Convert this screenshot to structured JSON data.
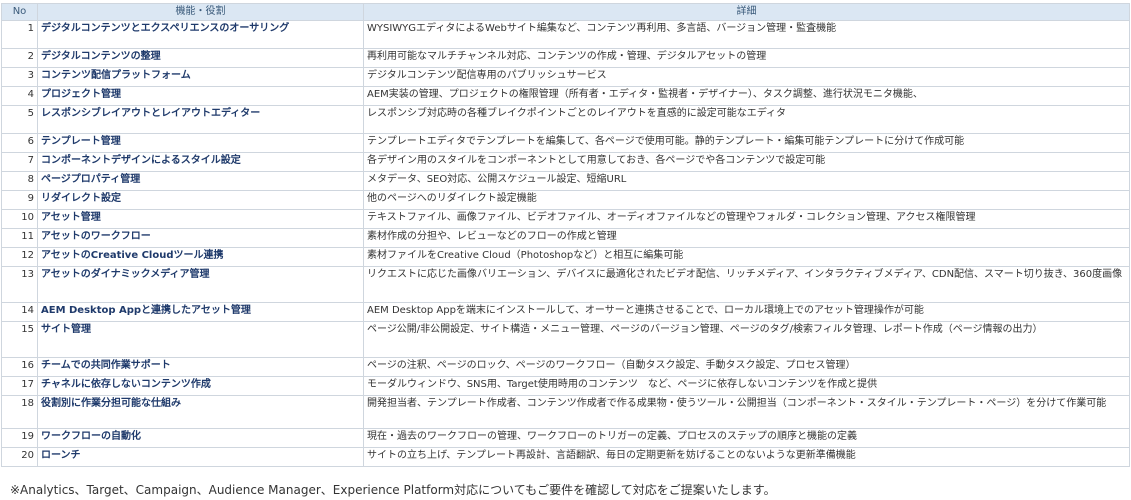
{
  "table": {
    "headers": {
      "no": "No",
      "function": "機能・役割",
      "detail": "詳細"
    },
    "rows": [
      {
        "no": "1",
        "function": "デジタルコンテンツとエクスペリエンスのオーサリング",
        "detail": "WYSIWYGエディタによるWebサイト編集など、コンテンツ再利用、多言語、バージョン管理・監査機能"
      },
      {
        "no": "2",
        "function": "デジタルコンテンツの整理",
        "detail": "再利用可能なマルチチャンネル対応、コンテンツの作成・管理、デジタルアセットの管理"
      },
      {
        "no": "3",
        "function": "コンテンツ配信プラットフォーム",
        "detail": "デジタルコンテンツ配信専用のパブリッシュサービス"
      },
      {
        "no": "4",
        "function": "プロジェクト管理",
        "detail": "AEM実装の管理、プロジェクトの権限管理（所有者・エディタ・監視者・デザイナー）、タスク調整、進行状況モニタ機能、"
      },
      {
        "no": "5",
        "function": "レスポンシブレイアウトとレイアウトエディター",
        "detail": "レスポンシブ対応時の各種ブレイクポイントごとのレイアウトを直感的に設定可能なエディタ"
      },
      {
        "no": "6",
        "function": "テンプレート管理",
        "detail": "テンプレートエディタでテンプレートを編集して、各ページで使用可能。静的テンプレート・編集可能テンプレートに分けて作成可能"
      },
      {
        "no": "7",
        "function": "コンポーネントデザインによるスタイル設定",
        "detail": "各デザイン用のスタイルをコンポーネントとして用意しておき、各ページでや各コンテンツで設定可能"
      },
      {
        "no": "8",
        "function": "ページプロパティ管理",
        "detail": "メタデータ、SEO対応、公開スケジュール設定、短縮URL"
      },
      {
        "no": "9",
        "function": "リダイレクト設定",
        "detail": "他のページへのリダイレクト設定機能"
      },
      {
        "no": "10",
        "function": "アセット管理",
        "detail": "テキストファイル、画像ファイル、ビデオファイル、オーディオファイルなどの管理やフォルダ・コレクション管理、アクセス権限管理"
      },
      {
        "no": "11",
        "function": "アセットのワークフロー",
        "detail": "素材作成の分担や、レビューなどのフローの作成と管理"
      },
      {
        "no": "12",
        "function": "アセットのCreative Cloudツール連携",
        "detail": "素材ファイルをCreative Cloud（Photoshopなど）と相互に編集可能"
      },
      {
        "no": "13",
        "function": "アセットのダイナミックメディア管理",
        "detail": "リクエストに応じた画像バリエーション、デバイスに最適化されたビデオ配信、リッチメディア、インタラクティブメディア、CDN配信、スマート切り抜き、360度画像"
      },
      {
        "no": "14",
        "function": "AEM Desktop Appと連携したアセット管理",
        "detail": "AEM Desktop Appを端末にインストールして、オーサーと連携させることで、ローカル環境上でのアセット管理操作が可能"
      },
      {
        "no": "15",
        "function": "サイト管理",
        "detail": "ページ公開/非公開設定、サイト構造・メニュー管理、ページのバージョン管理、ページのタグ/検索フィルタ管理、レポート作成（ページ情報の出力）"
      },
      {
        "no": "16",
        "function": "チームでの共同作業サポート",
        "detail": "ページの注釈、ページのロック、ページのワークフロー（自動タスク設定、手動タスク設定、プロセス管理）"
      },
      {
        "no": "17",
        "function": "チャネルに依存しないコンテンツ作成",
        "detail": "モーダルウィンドウ、SNS用、Target使用時用のコンテンツ　など、ページに依存しないコンテンツを作成と提供"
      },
      {
        "no": "18",
        "function": "役割別に作業分担可能な仕組み",
        "detail": "開発担当者、テンプレート作成者、コンテンツ作成者で作る成果物・使うツール・公開担当（コンポーネント・スタイル・テンプレート・ページ）を分けて作業可能"
      },
      {
        "no": "19",
        "function": "ワークフローの自動化",
        "detail": "現在・過去のワークフローの管理、ワークフローのトリガーの定義、プロセスのステップの順序と機能の定義"
      },
      {
        "no": "20",
        "function": "ローンチ",
        "detail": "サイトの立ち上げ、テンプレート再設計、言語翻訳、毎日の定期更新を妨げることのないような更新準備機能"
      }
    ]
  },
  "footnote": "※Analytics、Target、Campaign、Audience Manager、Experience Platform対応についてもご要件を確認して対応をご提案いたします。"
}
